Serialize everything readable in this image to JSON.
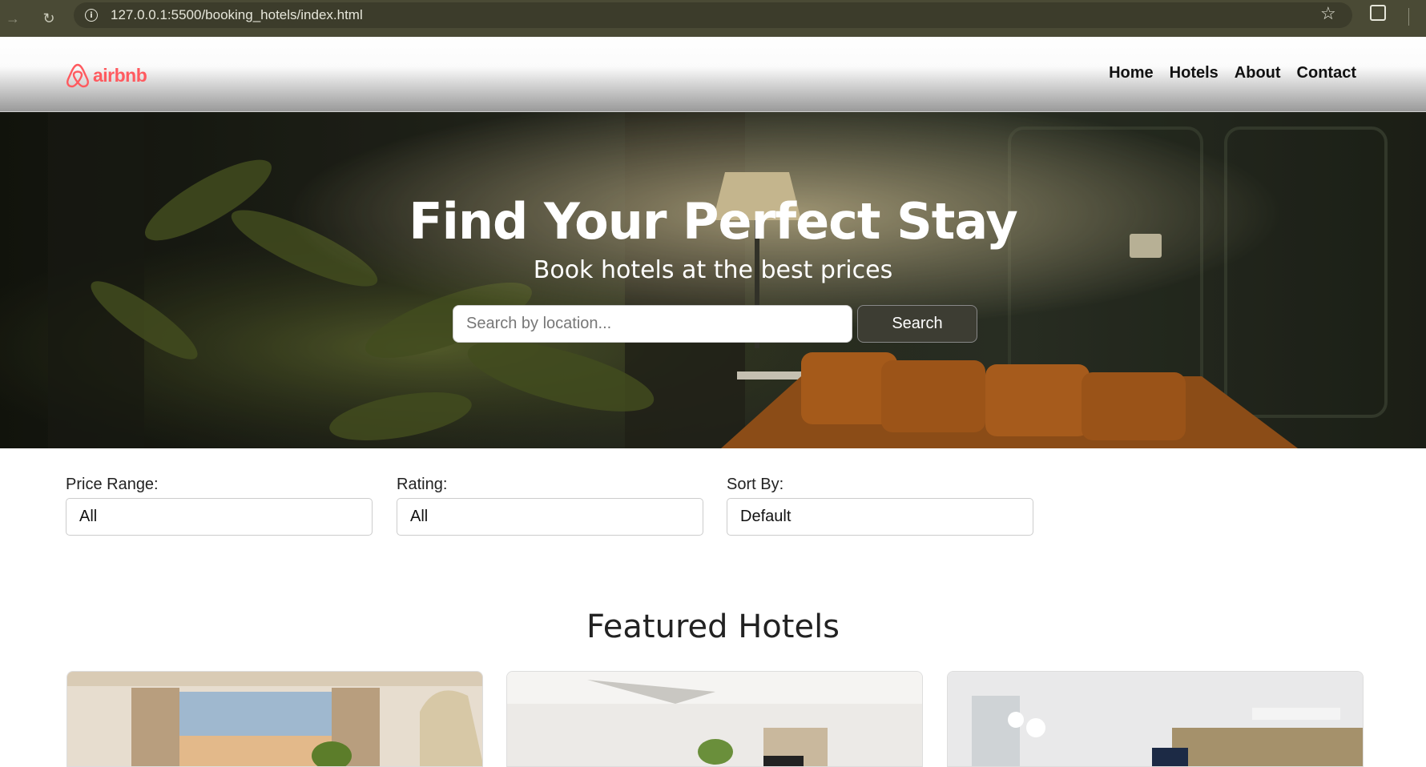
{
  "browser": {
    "url": "127.0.0.1:5500/booking_hotels/index.html",
    "icons": [
      "back-arrow-icon",
      "reload-icon",
      "site-info-icon",
      "bookmark-star-icon",
      "extensions-icon"
    ]
  },
  "header": {
    "logo_text": "airbnb",
    "nav": [
      {
        "label": "Home"
      },
      {
        "label": "Hotels"
      },
      {
        "label": "About"
      },
      {
        "label": "Contact"
      }
    ]
  },
  "hero": {
    "title": "Find Your Perfect Stay",
    "subtitle": "Book hotels at the best prices",
    "search_placeholder": "Search by location...",
    "search_button": "Search"
  },
  "filters": [
    {
      "label": "Price Range:",
      "value": "All"
    },
    {
      "label": "Rating:",
      "value": "All"
    },
    {
      "label": "Sort By:",
      "value": "Default"
    }
  ],
  "featured": {
    "title": "Featured Hotels"
  },
  "colors": {
    "brand": "#ff5a5f",
    "chrome": "#4a4a35",
    "button_dark": "#3d3d33"
  }
}
